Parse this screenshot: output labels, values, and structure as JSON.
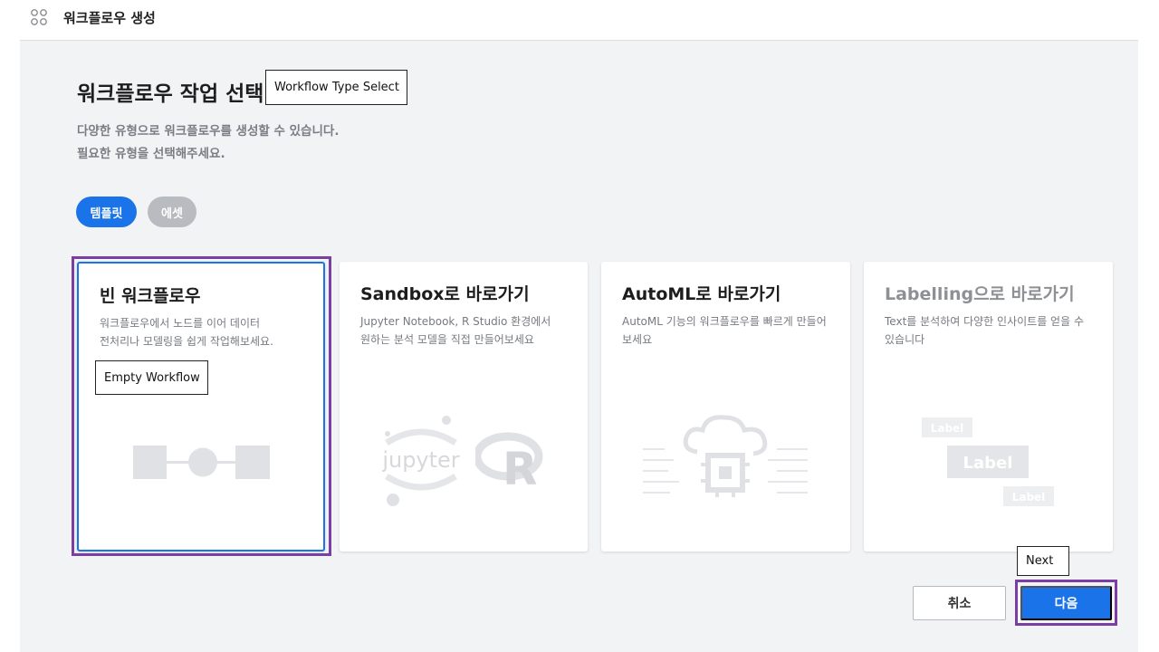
{
  "header": {
    "title": "워크플로우 생성",
    "icon": "apps-icon"
  },
  "page": {
    "title": "워크플로우 작업 선택",
    "subtitle_line1": "다양한 유형으로 워크플로우를 생성할 수 있습니다.",
    "subtitle_line2": "필요한 유형을 선택해주세요."
  },
  "annotations": {
    "workflow_type": "Workflow Type Select",
    "empty_workflow": "Empty Workflow",
    "next": "Next"
  },
  "tabs": [
    {
      "label": "템플릿",
      "active": true
    },
    {
      "label": "에셋",
      "active": false
    }
  ],
  "cards": [
    {
      "title": "빈 워크플로우",
      "desc1": "워크플로우에서 노드를 이어 데이터",
      "desc2": "전처리나 모델링을 쉽게 작업해보세요.",
      "selected": true
    },
    {
      "title": "Sandbox로 바로가기",
      "desc1": "Jupyter Notebook, R Studio 환경에서",
      "desc2": "원하는 분석 모델을 직접 만들어보세요",
      "selected": false
    },
    {
      "title": "AutoML로 바로가기",
      "desc1": "AutoML 기능의 워크플로우를 빠르게 만들어",
      "desc2": "보세요",
      "selected": false
    },
    {
      "title": "Labelling으로 바로가기",
      "desc1": "Text를 분석하여 다양한 인사이트를 얻을 수",
      "desc2": "있습니다",
      "selected": false,
      "disabled": true
    }
  ],
  "illustrations": {
    "jupyter_text": "jupyter",
    "r_text": "R",
    "label_small_1": "Label",
    "label_big": "Label",
    "label_small_2": "Label"
  },
  "buttons": {
    "cancel": "취소",
    "next": "다음"
  },
  "colors": {
    "primary": "#1a73e8",
    "selection_outline": "#7b3fa4",
    "background": "#f2f3f5"
  }
}
